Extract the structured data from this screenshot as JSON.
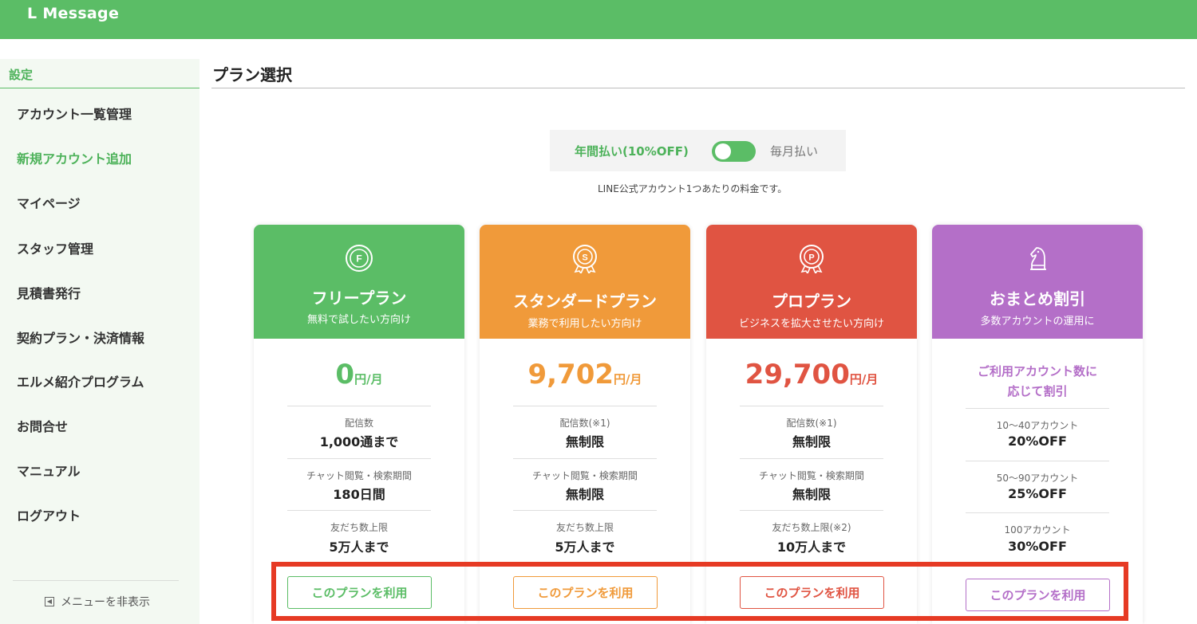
{
  "app": {
    "logo": "L Message"
  },
  "sidebar": {
    "section_title": "設定",
    "items": [
      {
        "label": "アカウント一覧管理",
        "active": false
      },
      {
        "label": "新規アカウント追加",
        "active": true
      },
      {
        "label": "マイページ",
        "active": false
      },
      {
        "label": "スタッフ管理",
        "active": false
      },
      {
        "label": "見積書発行",
        "active": false
      },
      {
        "label": "契約プラン・決済情報",
        "active": false
      },
      {
        "label": "エルメ紹介プログラム",
        "active": false
      },
      {
        "label": "お問合せ",
        "active": false
      },
      {
        "label": "マニュアル",
        "active": false
      },
      {
        "label": "ログアウト",
        "active": false
      }
    ],
    "hide_menu": "メニューを非表示"
  },
  "main": {
    "title": "プラン選択",
    "billing": {
      "yearly": "年間払い(10%OFF)",
      "monthly": "毎月払い",
      "yearly_selected": true
    },
    "note": "LINE公式アカウント1つあたりの料金です。"
  },
  "colors": {
    "free": "#5bbd66",
    "standard": "#f09a3a",
    "pro": "#e05442",
    "bundle": "#b46fc8",
    "highlight": "#e63a24"
  },
  "plans": [
    {
      "icon": "free-badge-icon",
      "name": "フリープラン",
      "subtitle": "無料で試したい方向け",
      "price": "0",
      "unit": "円/月",
      "features": [
        {
          "label": "配信数",
          "value": "1,000通まで"
        },
        {
          "label": "チャット閲覧・検索期間",
          "value": "180日間"
        },
        {
          "label": "友だち数上限",
          "value": "5万人まで"
        }
      ],
      "button": "このプランを利用"
    },
    {
      "icon": "standard-medal-icon",
      "name": "スタンダードプラン",
      "subtitle": "業務で利用したい方向け",
      "price": "9,702",
      "unit": "円/月",
      "features": [
        {
          "label": "配信数(※1)",
          "value": "無制限"
        },
        {
          "label": "チャット閲覧・検索期間",
          "value": "無制限"
        },
        {
          "label": "友だち数上限",
          "value": "5万人まで"
        }
      ],
      "button": "このプランを利用"
    },
    {
      "icon": "pro-medal-icon",
      "name": "プロプラン",
      "subtitle": "ビジネスを拡大させたい方向け",
      "price": "29,700",
      "unit": "円/月",
      "features": [
        {
          "label": "配信数(※1)",
          "value": "無制限"
        },
        {
          "label": "チャット閲覧・検索期間",
          "value": "無制限"
        },
        {
          "label": "友だち数上限(※2)",
          "value": "10万人まで"
        }
      ],
      "button": "このプランを利用"
    },
    {
      "icon": "chess-knight-icon",
      "name": "おまとめ割引",
      "subtitle": "多数アカウントの運用に",
      "promo_line1": "ご利用アカウント数に",
      "promo_line2": "応じて割引",
      "features": [
        {
          "label": "10〜40アカウント",
          "value": "20%OFF"
        },
        {
          "label": "50〜90アカウント",
          "value": "25%OFF"
        },
        {
          "label": "100アカウント",
          "value": "30%OFF"
        }
      ],
      "button": "このプランを利用"
    }
  ]
}
